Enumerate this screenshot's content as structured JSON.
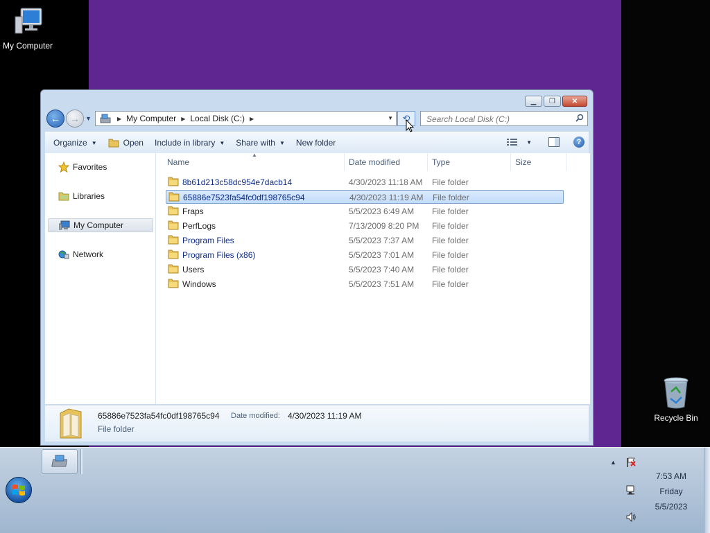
{
  "desktop": {
    "my_computer_label": "My Computer",
    "recycle_bin_label": "Recycle Bin"
  },
  "window": {
    "address": {
      "crumbs": [
        "My Computer",
        "Local Disk (C:)"
      ]
    },
    "search": {
      "placeholder": "Search Local Disk (C:)"
    },
    "toolbar": {
      "organize": "Organize",
      "open": "Open",
      "include_in_library": "Include in library",
      "share_with": "Share with",
      "new_folder": "New folder"
    },
    "nav_pane": {
      "favorites": "Favorites",
      "libraries": "Libraries",
      "my_computer": "My Computer",
      "network": "Network"
    },
    "columns": {
      "name": "Name",
      "date_modified": "Date modified",
      "type": "Type",
      "size": "Size"
    },
    "files": [
      {
        "name": "8b61d213c58dc954e7dacb14",
        "date": "4/30/2023 11:18 AM",
        "type": "File folder"
      },
      {
        "name": "65886e7523fa54fc0df198765c94",
        "date": "4/30/2023 11:19 AM",
        "type": "File folder"
      },
      {
        "name": "Fraps",
        "date": "5/5/2023 6:49 AM",
        "type": "File folder"
      },
      {
        "name": "PerfLogs",
        "date": "7/13/2009 8:20 PM",
        "type": "File folder"
      },
      {
        "name": "Program Files",
        "date": "5/5/2023 7:37 AM",
        "type": "File folder"
      },
      {
        "name": "Program Files (x86)",
        "date": "5/5/2023 7:01 AM",
        "type": "File folder"
      },
      {
        "name": "Users",
        "date": "5/5/2023 7:40 AM",
        "type": "File folder"
      },
      {
        "name": "Windows",
        "date": "5/5/2023 7:51 AM",
        "type": "File folder"
      }
    ],
    "details": {
      "name": "65886e7523fa54fc0df198765c94",
      "date_label": "Date modified:",
      "date_value": "4/30/2023 11:19 AM",
      "type": "File folder"
    }
  },
  "taskbar": {
    "clock": {
      "time": "7:53 AM",
      "day": "Friday",
      "date": "5/5/2023"
    }
  },
  "colors": {
    "wallpaper": "#5f2590",
    "selection": "#c1dcfc",
    "folder": "#e8c35a"
  }
}
